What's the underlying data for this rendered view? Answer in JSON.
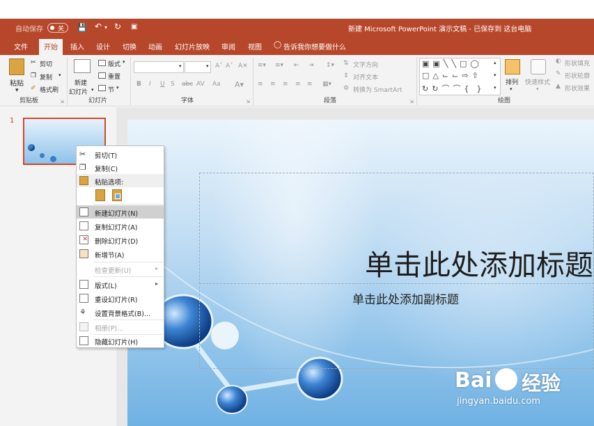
{
  "titlebar": {
    "autosave_label": "自动保存",
    "autosave_toggle": "关",
    "doc_title": "新建 Microsoft PowerPoint 演示文稿 - 已保存到 这台电脑"
  },
  "tabs": [
    "文件",
    "开始",
    "插入",
    "设计",
    "切换",
    "动画",
    "幻灯片放映",
    "审阅",
    "视图"
  ],
  "tell_me": "告诉我你想要做什么",
  "ribbon": {
    "clipboard": {
      "paste": "粘贴",
      "cut": "剪切",
      "copy": "复制",
      "format_painter": "格式刷",
      "group": "剪贴板"
    },
    "slides": {
      "new_slide_line1": "新建",
      "new_slide_line2": "幻灯片",
      "layout": "版式",
      "reset": "重置",
      "section": "节",
      "group": "幻灯片"
    },
    "font": {
      "bold": "B",
      "italic": "I",
      "underline": "U",
      "strike": "S",
      "abc": "abc",
      "spacing": "AV",
      "case": "Aa",
      "group": "字体"
    },
    "paragraph": {
      "text_direction": "文字方向",
      "align_text": "对齐文本",
      "smartart": "转换为 SmartArt",
      "group": "段落"
    },
    "drawing": {
      "arrange": "排列",
      "quick_styles": "快速样式",
      "shape_fill": "形状填充",
      "shape_outline": "形状轮廓",
      "shape_effects": "形状效果",
      "group": "绘图"
    }
  },
  "thumbnail": {
    "number": "1"
  },
  "slide": {
    "title": "单击此处添加标题",
    "subtitle": "单击此处添加副标题"
  },
  "context_menu": {
    "cut": "剪切(T)",
    "copy": "复制(C)",
    "paste_options": "粘贴选项:",
    "new_slide": "新建幻灯片(N)",
    "duplicate_slide": "复制幻灯片(A)",
    "delete_slide": "删除幻灯片(D)",
    "add_section": "新增节(A)",
    "check_updates": "检查更新(U)",
    "layout": "版式(L)",
    "reset_slide": "重设幻灯片(R)",
    "format_background": "设置背景格式(B)...",
    "photo_album": "相册(P)...",
    "hide_slide": "隐藏幻灯片(H)"
  },
  "watermark": {
    "brand": "Bai",
    "brand2": "经验",
    "url": "jingyan.baidu.com"
  },
  "colors": {
    "accent": "#b7472a",
    "menu_highlight": "#d0d0d0"
  }
}
